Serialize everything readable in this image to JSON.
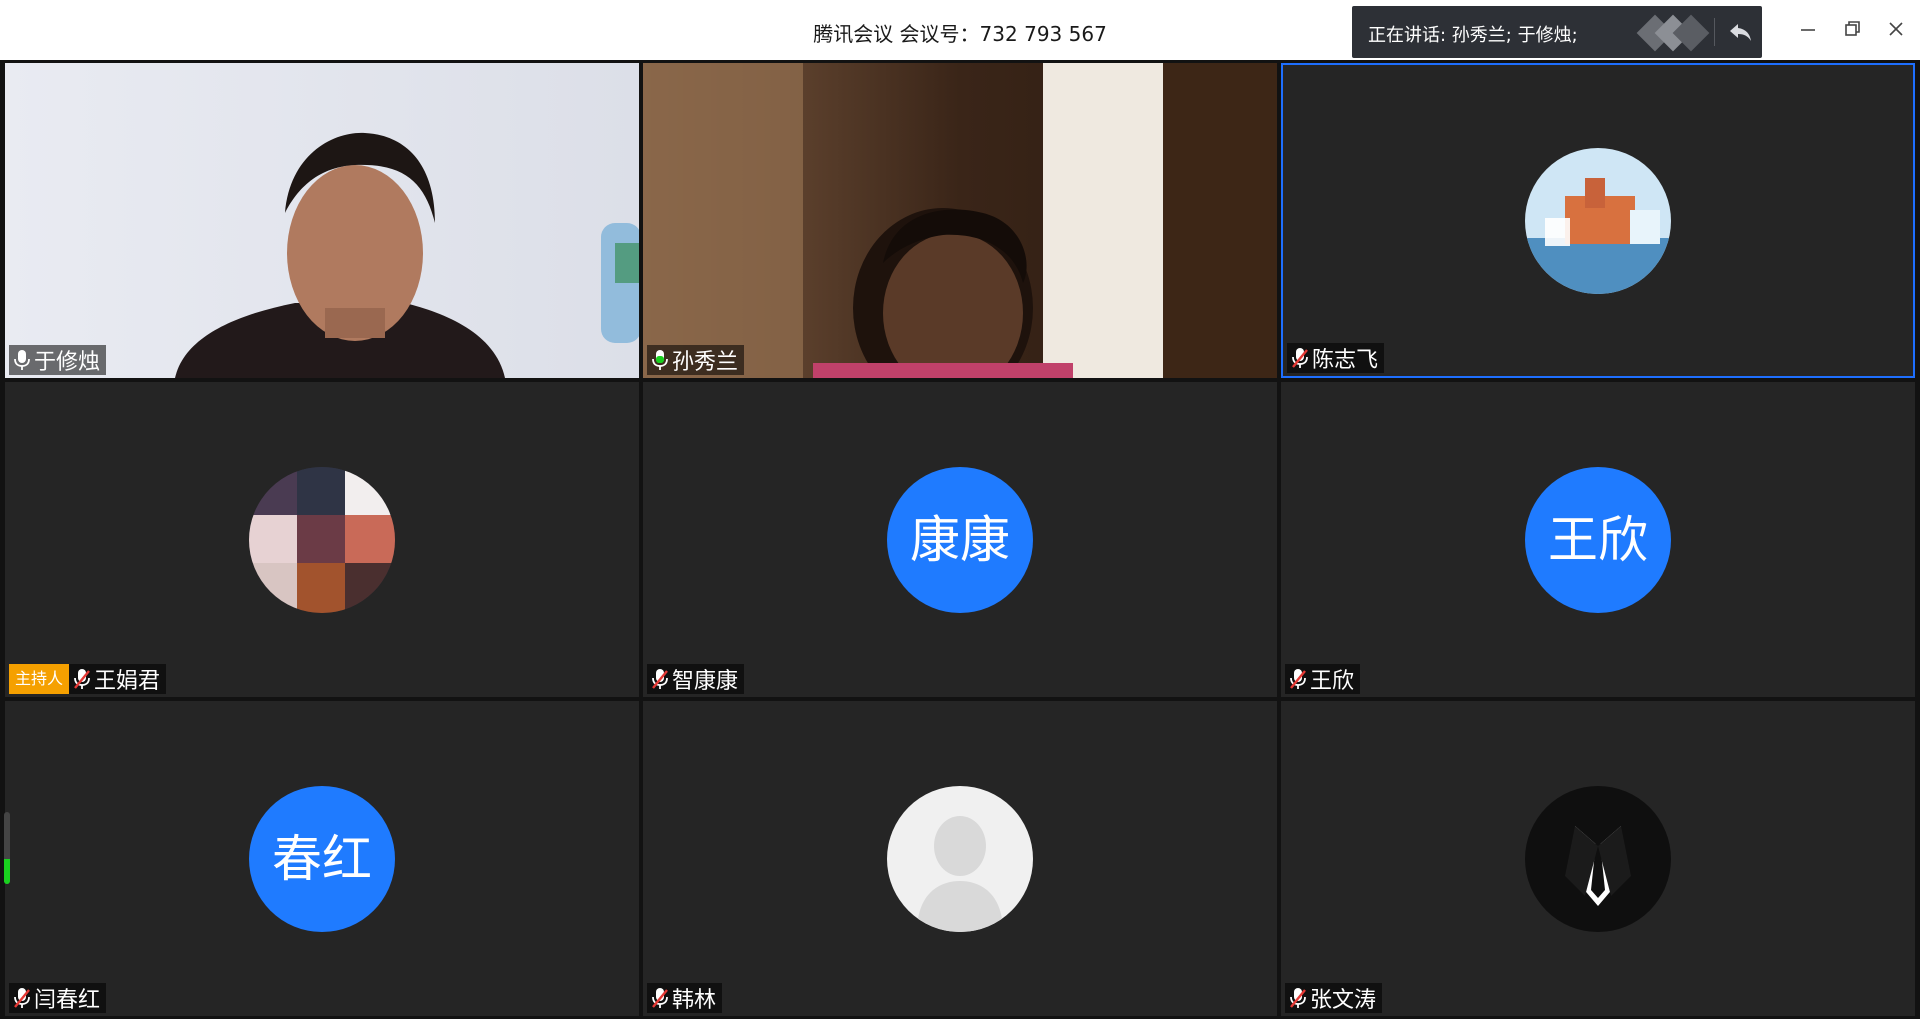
{
  "window": {
    "title": "腾讯会议 会议号：732 793 567"
  },
  "speaking": {
    "text": "正在讲话: 孙秀兰; 于修烛;"
  },
  "tiles": [
    {
      "name": "于修烛",
      "kind": "video",
      "mic": "active"
    },
    {
      "name": "孙秀兰",
      "kind": "video",
      "mic": "speaking"
    },
    {
      "name": "陈志飞",
      "kind": "image-avatar",
      "mic": "muted",
      "active": true
    },
    {
      "name": "王娟君",
      "kind": "image-avatar",
      "mic": "muted",
      "host_badge": "主持人"
    },
    {
      "name": "智康康",
      "kind": "text-avatar",
      "avatar_text": "康康",
      "mic": "muted"
    },
    {
      "name": "王欣",
      "kind": "text-avatar",
      "avatar_text": "王欣",
      "mic": "muted"
    },
    {
      "name": "闫春红",
      "kind": "text-avatar",
      "avatar_text": "春红",
      "mic": "muted"
    },
    {
      "name": "韩林",
      "kind": "default-avatar",
      "mic": "muted"
    },
    {
      "name": "张文涛",
      "kind": "image-avatar",
      "mic": "muted"
    }
  ],
  "volume_level": 0.35,
  "colors": {
    "avatar_blue": "#1f7bff",
    "active_border": "#1e6fff",
    "host_badge": "#f5a000",
    "muted_red": "#e53935",
    "speaking_green": "#19d11f"
  },
  "icons": {
    "minimize": "minimize-icon",
    "restore": "restore-icon",
    "close": "close-icon",
    "reply": "reply-icon",
    "mic": "microphone-icon",
    "mic_muted": "microphone-muted-icon"
  }
}
